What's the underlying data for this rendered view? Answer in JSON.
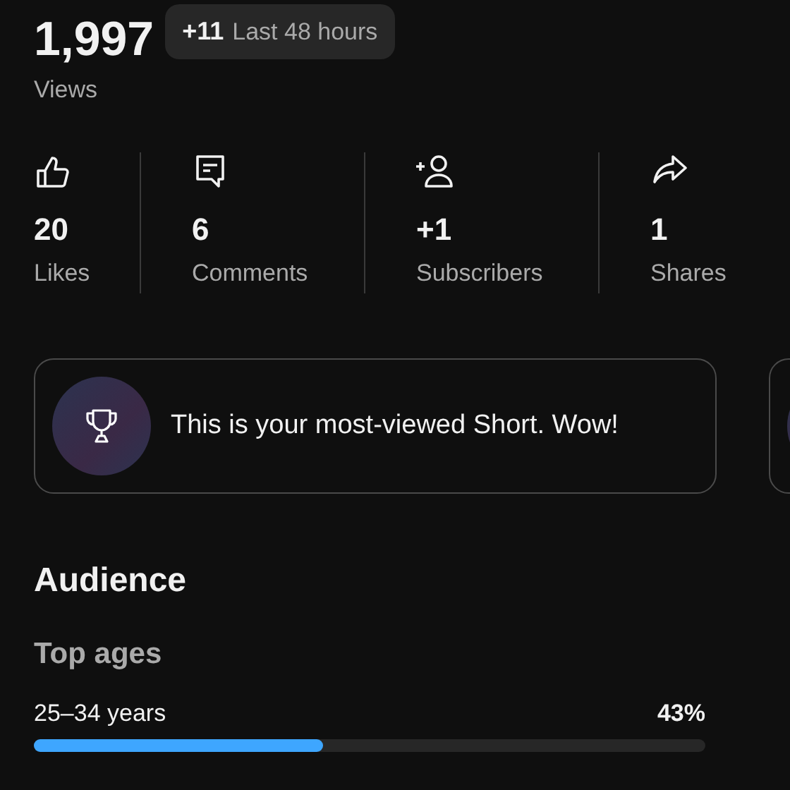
{
  "views": {
    "value": "1,997",
    "label": "Views",
    "badge": {
      "delta": "+11",
      "period": "Last 48 hours"
    }
  },
  "stats": [
    {
      "kind": "likes",
      "value": "20",
      "label": "Likes"
    },
    {
      "kind": "comments",
      "value": "6",
      "label": "Comments"
    },
    {
      "kind": "subscribers",
      "value": "+1",
      "label": "Subscribers"
    },
    {
      "kind": "shares",
      "value": "1",
      "label": "Shares"
    }
  ],
  "highlights": [
    {
      "kind": "card",
      "text": "This is your most-viewed Short. Wow!"
    },
    {
      "kind": "card"
    }
  ],
  "audience": {
    "title": "Audience",
    "groups": [
      {
        "title": "Top ages",
        "items": [
          {
            "label": "25–34 years",
            "value": "43%",
            "level": 0.43
          }
        ]
      }
    ]
  }
}
